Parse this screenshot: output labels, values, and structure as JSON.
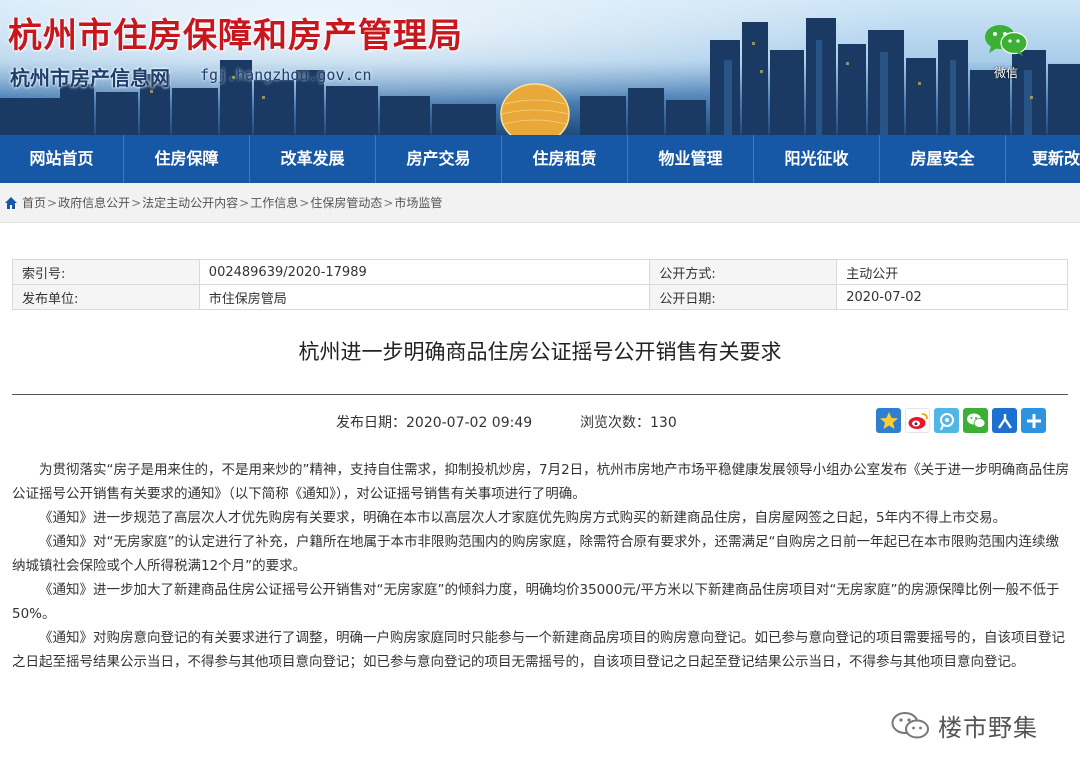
{
  "banner": {
    "title": "杭州市住房保障和房产管理局",
    "subtitle": "杭州市房产信息网",
    "url": "fgj.hangzhou.gov.cn",
    "wechat_label": "微信"
  },
  "nav": {
    "items": [
      "网站首页",
      "住房保障",
      "改革发展",
      "房产交易",
      "住房租赁",
      "物业管理",
      "阳光征收",
      "房屋安全",
      "更新改"
    ]
  },
  "breadcrumb": {
    "items": [
      "首页",
      "政府信息公开",
      "法定主动公开内容",
      "工作信息",
      "住保房管动态",
      "市场监管"
    ],
    "separator": ">"
  },
  "info": {
    "index_label": "索引号:",
    "index_value": "002489639/2020-17989",
    "open_method_label": "公开方式:",
    "open_method_value": "主动公开",
    "publisher_label": "发布单位:",
    "publisher_value": "市住保房管局",
    "open_date_label": "公开日期:",
    "open_date_value": "2020-07-02"
  },
  "article": {
    "title": "杭州进一步明确商品住房公证摇号公开销售有关要求",
    "publish_date": "发布日期：2020-07-02 09:49",
    "views": "浏览次数：130",
    "paragraphs": [
      "为贯彻落实“房子是用来住的，不是用来炒的”精神，支持自住需求，抑制投机炒房，7月2日，杭州市房地产市场平稳健康发展领导小组办公室发布《关于进一步明确商品住房公证摇号公开销售有关要求的通知》（以下简称《通知》），对公证摇号销售有关事项进行了明确。",
      "《通知》进一步规范了高层次人才优先购房有关要求，明确在本市以高层次人才家庭优先购房方式购买的新建商品住房，自房屋网签之日起，5年内不得上市交易。",
      "《通知》对“无房家庭”的认定进行了补充，户籍所在地属于本市非限购范围内的购房家庭，除需符合原有要求外，还需满足“自购房之日前一年起已在本市限购范围内连续缴纳城镇社会保险或个人所得税满12个月”的要求。",
      "《通知》进一步加大了新建商品住房公证摇号公开销售对“无房家庭”的倾斜力度，明确均价35000元/平方米以下新建商品住房项目对“无房家庭”的房源保障比例一般不低于50%。",
      "《通知》对购房意向登记的有关要求进行了调整，明确一户购房家庭同时只能参与一个新建商品房项目的购房意向登记。如已参与意向登记的项目需要摇号的，自该项目登记之日起至摇号结果公示当日，不得参与其他项目意向登记；如已参与意向登记的项目无需摇号的，自该项目登记之日起至登记结果公示当日，不得参与其他项目意向登记。"
    ]
  },
  "share": {
    "icons": [
      "qzone-icon",
      "weibo-icon",
      "tencent-weibo-icon",
      "wechat-share-icon",
      "renren-icon",
      "more-share-icon"
    ]
  },
  "watermark": {
    "text": "楼市野集"
  },
  "colors": {
    "nav_bg": "#1658a6",
    "title_red": "#c8161d",
    "wechat_green": "#3cb034"
  }
}
